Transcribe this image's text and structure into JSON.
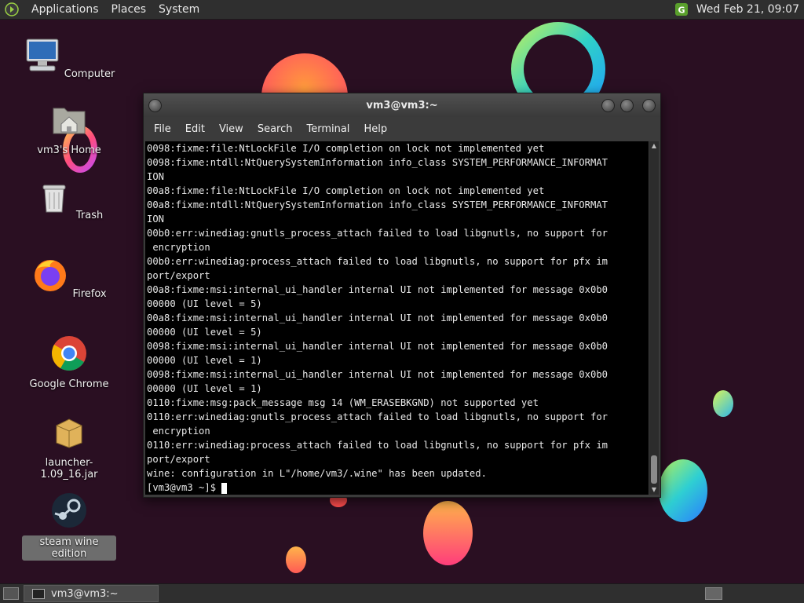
{
  "top_panel": {
    "menus": [
      "Applications",
      "Places",
      "System"
    ],
    "clock": "Wed Feb 21, 09:07"
  },
  "desktop_icons": [
    {
      "label": "Computer"
    },
    {
      "label": "vm3's Home"
    },
    {
      "label": "Trash"
    },
    {
      "label": "Firefox"
    },
    {
      "label": "Google Chrome"
    },
    {
      "label": "launcher-1.09_16.jar"
    },
    {
      "label": "steam wine edition"
    }
  ],
  "terminal": {
    "title": "vm3@vm3:~",
    "menu": [
      "File",
      "Edit",
      "View",
      "Search",
      "Terminal",
      "Help"
    ],
    "lines": [
      "0098:fixme:file:NtLockFile I/O completion on lock not implemented yet",
      "0098:fixme:ntdll:NtQuerySystemInformation info_class SYSTEM_PERFORMANCE_INFORMAT",
      "ION",
      "00a8:fixme:file:NtLockFile I/O completion on lock not implemented yet",
      "00a8:fixme:ntdll:NtQuerySystemInformation info_class SYSTEM_PERFORMANCE_INFORMAT",
      "ION",
      "00b0:err:winediag:gnutls_process_attach failed to load libgnutls, no support for",
      " encryption",
      "00b0:err:winediag:process_attach failed to load libgnutls, no support for pfx im",
      "port/export",
      "00a8:fixme:msi:internal_ui_handler internal UI not implemented for message 0x0b0",
      "00000 (UI level = 5)",
      "00a8:fixme:msi:internal_ui_handler internal UI not implemented for message 0x0b0",
      "00000 (UI level = 5)",
      "0098:fixme:msi:internal_ui_handler internal UI not implemented for message 0x0b0",
      "00000 (UI level = 1)",
      "0098:fixme:msi:internal_ui_handler internal UI not implemented for message 0x0b0",
      "00000 (UI level = 1)",
      "0110:fixme:msg:pack_message msg 14 (WM_ERASEBKGND) not supported yet",
      "0110:err:winediag:gnutls_process_attach failed to load libgnutls, no support for",
      " encryption",
      "0110:err:winediag:process_attach failed to load libgnutls, no support for pfx im",
      "port/export",
      "wine: configuration in L\"/home/vm3/.wine\" has been updated."
    ],
    "prompt": "[vm3@vm3 ~]$ "
  },
  "bottom_panel": {
    "task_label": "vm3@vm3:~"
  },
  "colors": {
    "wallpaper": "#2a0f22",
    "panel": "#2f2f2f",
    "terminal_bg": "#000000"
  }
}
